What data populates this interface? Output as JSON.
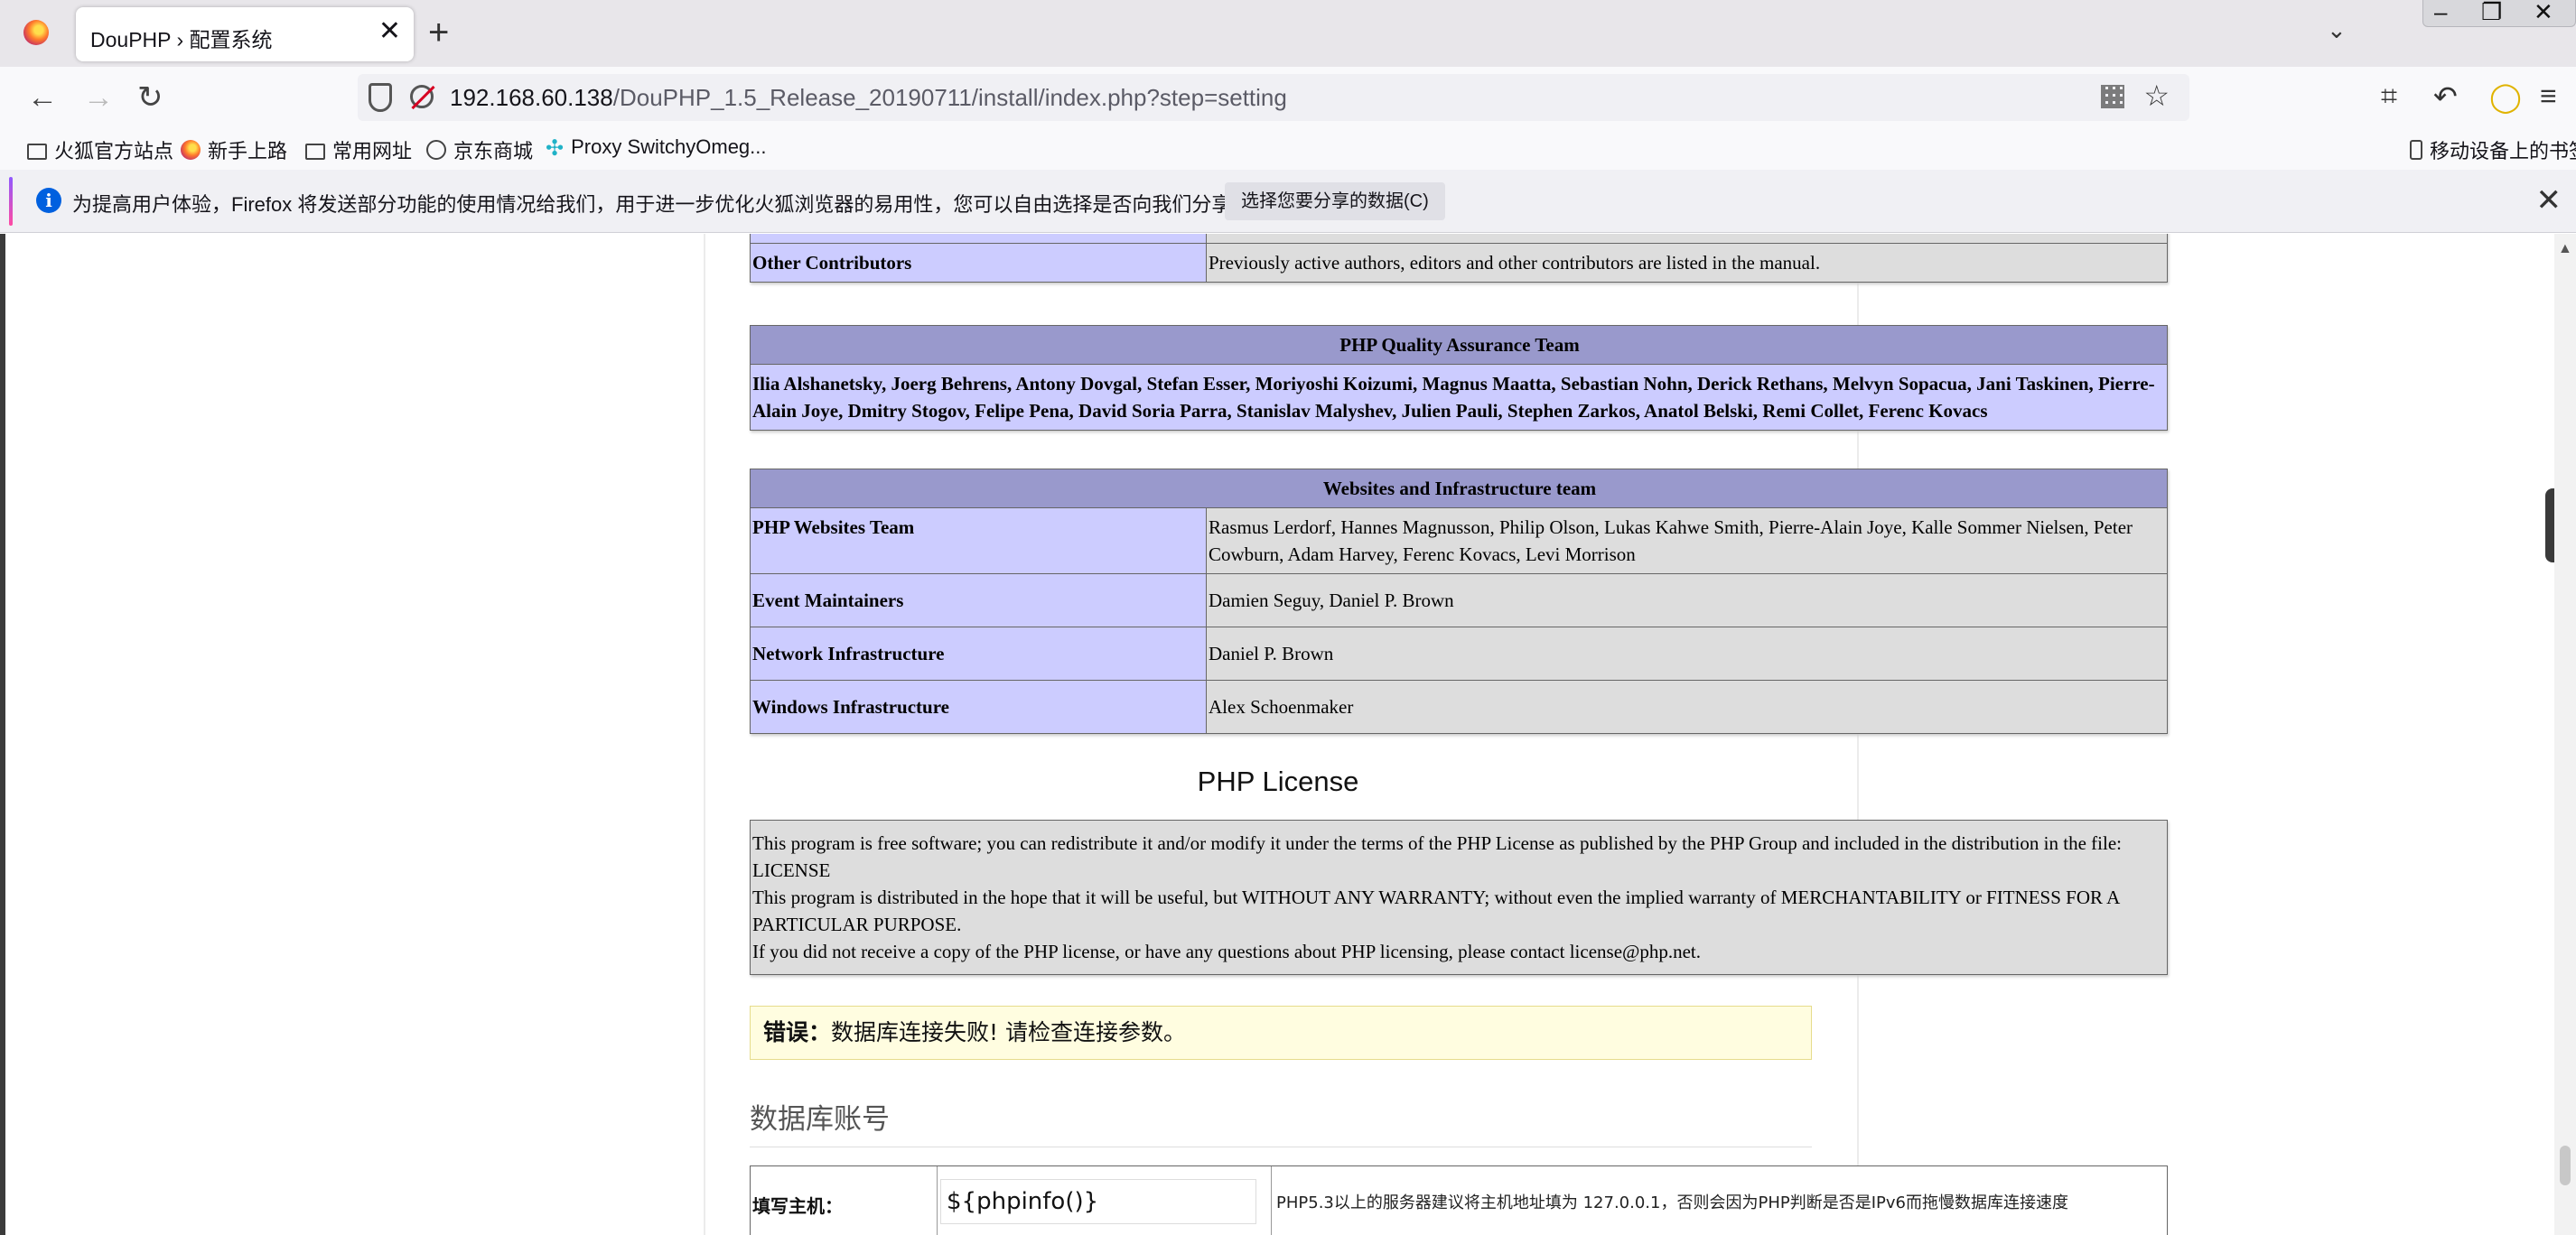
{
  "browser": {
    "tab_title": "DouPHP › 配置系统",
    "tab_close": "✕",
    "new_tab": "+",
    "tab_list": "⌄",
    "url_host": "192.168.60.138",
    "url_path": "/DouPHP_1.5_Release_20190711/install/index.php?step=setting",
    "bookmarks": [
      "火狐官方站点",
      "新手上路",
      "常用网址",
      "京东商城",
      "Proxy SwitchyOmeg..."
    ],
    "mobile_bookmarks": "移动设备上的书签",
    "info_text": "为提高用户体验，Firefox 将发送部分功能的使用情况给我们，用于进一步优化火狐浏览器的易用性，您可以自由选择是否向我们分享数据。",
    "info_button": "选择您要分享的数据(C)"
  },
  "credits": {
    "other_contributors": {
      "label": "Other Contributors",
      "value": "Previously active authors, editors and other contributors are listed in the manual."
    },
    "qa_team": {
      "heading": "PHP Quality Assurance Team",
      "names": "Ilia Alshanetsky, Joerg Behrens, Antony Dovgal, Stefan Esser, Moriyoshi Koizumi, Magnus Maatta, Sebastian Nohn, Derick Rethans, Melvyn Sopacua, Jani Taskinen, Pierre-Alain Joye, Dmitry Stogov, Felipe Pena, David Soria Parra, Stanislav Malyshev, Julien Pauli, Stephen Zarkos, Anatol Belski, Remi Collet, Ferenc Kovacs"
    },
    "websites_team": {
      "heading": "Websites and Infrastructure team",
      "rows": [
        {
          "label": "PHP Websites Team",
          "value": "Rasmus Lerdorf, Hannes Magnusson, Philip Olson, Lukas Kahwe Smith, Pierre-Alain Joye, Kalle Sommer Nielsen, Peter Cowburn, Adam Harvey, Ferenc Kovacs, Levi Morrison"
        },
        {
          "label": "Event Maintainers",
          "value": "Damien Seguy, Daniel P. Brown"
        },
        {
          "label": "Network Infrastructure",
          "value": "Daniel P. Brown"
        },
        {
          "label": "Windows Infrastructure",
          "value": "Alex Schoenmaker"
        }
      ]
    }
  },
  "license": {
    "title": "PHP License",
    "line1": "This program is free software; you can redistribute it and/or modify it under the terms of the PHP License as published by the PHP Group and included in the distribution in the file: LICENSE",
    "line2": "This program is distributed in the hope that it will be useful, but WITHOUT ANY WARRANTY; without even the implied warranty of MERCHANTABILITY or FITNESS FOR A PARTICULAR PURPOSE.",
    "line3": "If you did not receive a copy of the PHP license, or have any questions about PHP licensing, please contact license@php.net."
  },
  "error": {
    "label": "错误：",
    "message": "数据库连接失败! 请检查连接参数。"
  },
  "db_section": {
    "heading": "数据库账号",
    "host_label": "填写主机：",
    "host_value": "${phpinfo()}",
    "host_hint": "PHP5.3以上的服务器建议将主机地址填为 127.0.0.1，否则会因为PHP判断是否是IPv6而拖慢数据库连接速度"
  },
  "colors": {
    "php_header": "#9999cc",
    "php_label": "#ccccff",
    "php_value": "#dddddd",
    "error_bg": "#fffde0"
  }
}
